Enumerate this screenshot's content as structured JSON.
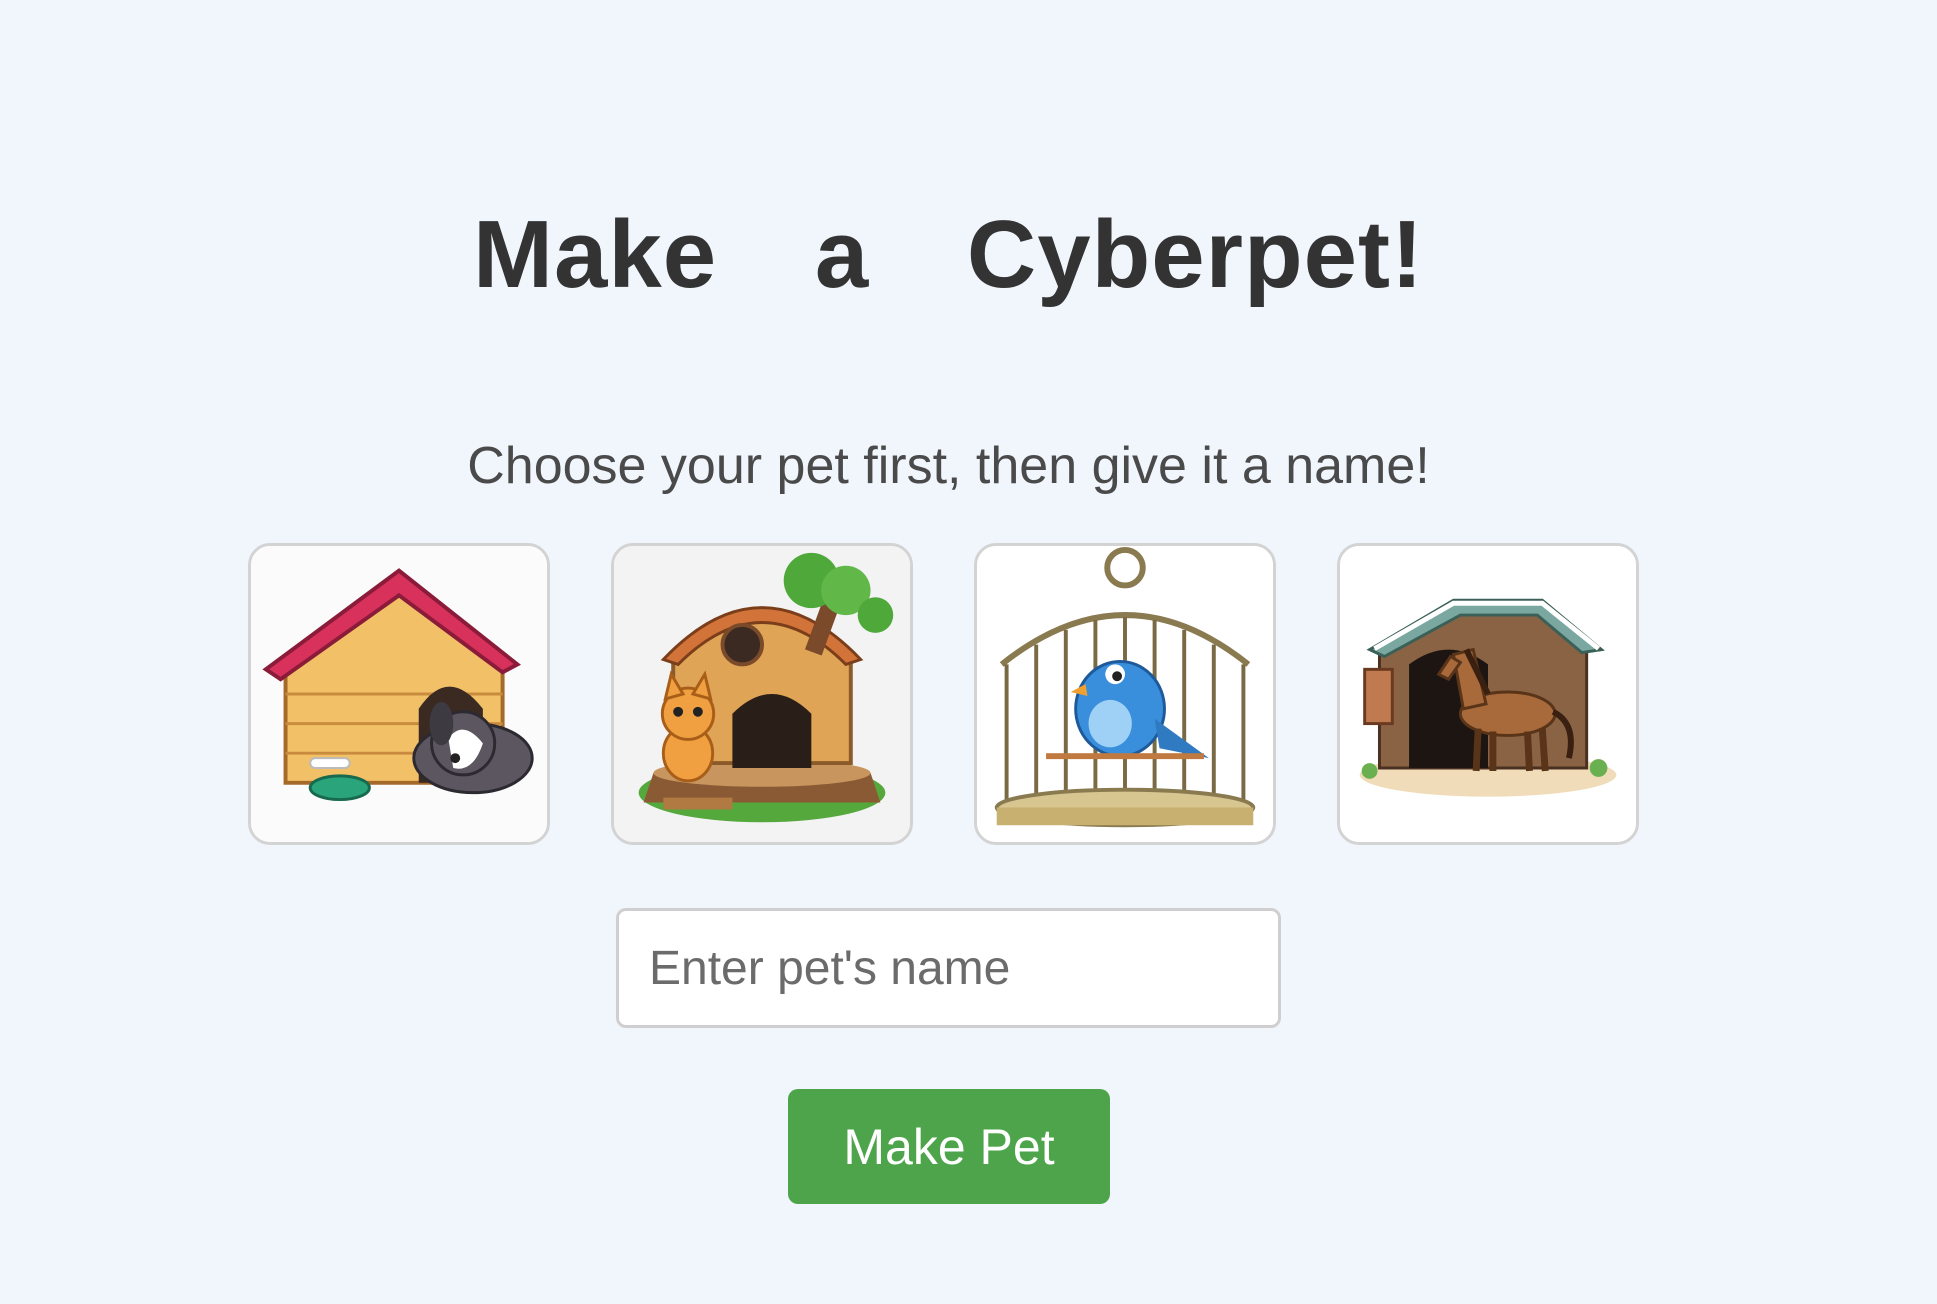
{
  "page": {
    "title": "Make a Cyberpet!",
    "subtitle": "Choose your pet first, then give it a name!"
  },
  "pets": [
    {
      "kind": "dog",
      "icon": "dog-in-doghouse-icon"
    },
    {
      "kind": "cat",
      "icon": "cat-in-treehouse-icon"
    },
    {
      "kind": "bird",
      "icon": "bird-in-cage-icon"
    },
    {
      "kind": "horse",
      "icon": "horse-in-stable-icon"
    }
  ],
  "form": {
    "name_placeholder": "Enter pet's name",
    "name_value": "",
    "submit_label": "Make Pet"
  },
  "colors": {
    "background": "#f1f6fd",
    "button": "#4ea44b",
    "button_text": "#ffffff",
    "title": "#333333"
  }
}
